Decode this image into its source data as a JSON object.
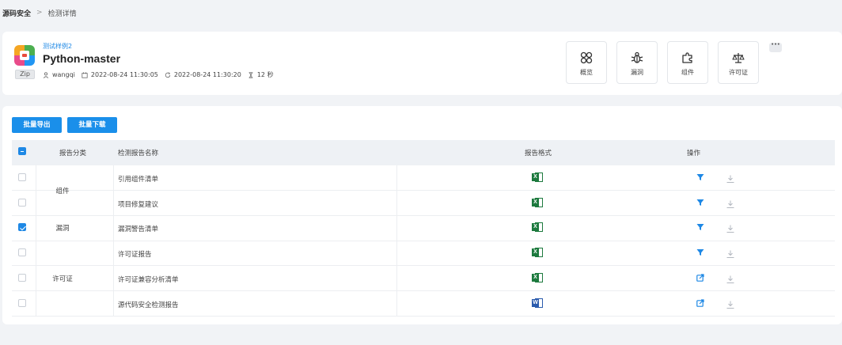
{
  "breadcrumb": {
    "root": "源码安全",
    "separator": ">",
    "current": "检测详情"
  },
  "project": {
    "sample_link": "测试样例2",
    "title": "Python-master",
    "type_tag": "Zip",
    "user": "wangqi",
    "start_time": "2022-08-24 11:30:05",
    "end_time": "2022-08-24 11:30:20",
    "duration": "12 秒"
  },
  "nav": [
    {
      "label": "概览",
      "icon": "overview-icon"
    },
    {
      "label": "漏洞",
      "icon": "bug-icon"
    },
    {
      "label": "组件",
      "icon": "puzzle-icon"
    },
    {
      "label": "许可证",
      "icon": "scale-icon"
    }
  ],
  "more_label": "···",
  "buttons": {
    "export": "批量导出",
    "download": "批量下载"
  },
  "table": {
    "headers": {
      "category": "报告分类",
      "name": "检测报告名称",
      "format": "报告格式",
      "action": "操作"
    },
    "groups": [
      {
        "label": "组件",
        "rows": 2
      },
      {
        "label": "漏洞",
        "rows": 1
      },
      {
        "label": "许可证",
        "rows": 3
      }
    ],
    "rows": [
      {
        "name": "引用组件清单",
        "format": "xls",
        "format_letter": "X",
        "checked": false,
        "action_icon": "filter-icon"
      },
      {
        "name": "项目修复建议",
        "format": "xls",
        "format_letter": "X",
        "checked": false,
        "action_icon": "filter-icon"
      },
      {
        "name": "漏洞警告清单",
        "format": "xls",
        "format_letter": "X",
        "checked": true,
        "action_icon": "filter-icon"
      },
      {
        "name": "许可证报告",
        "format": "xls",
        "format_letter": "X",
        "checked": false,
        "action_icon": "filter-icon"
      },
      {
        "name": "许可证兼容分析清单",
        "format": "xls",
        "format_letter": "X",
        "checked": false,
        "action_icon": "share-icon"
      },
      {
        "name": "源代码安全检测报告",
        "format": "doc",
        "format_letter": "W",
        "checked": false,
        "action_icon": "share-icon"
      }
    ]
  },
  "colors": {
    "primary": "#1a8fea",
    "excel": "#1d7a3e",
    "word": "#2b5bad"
  }
}
